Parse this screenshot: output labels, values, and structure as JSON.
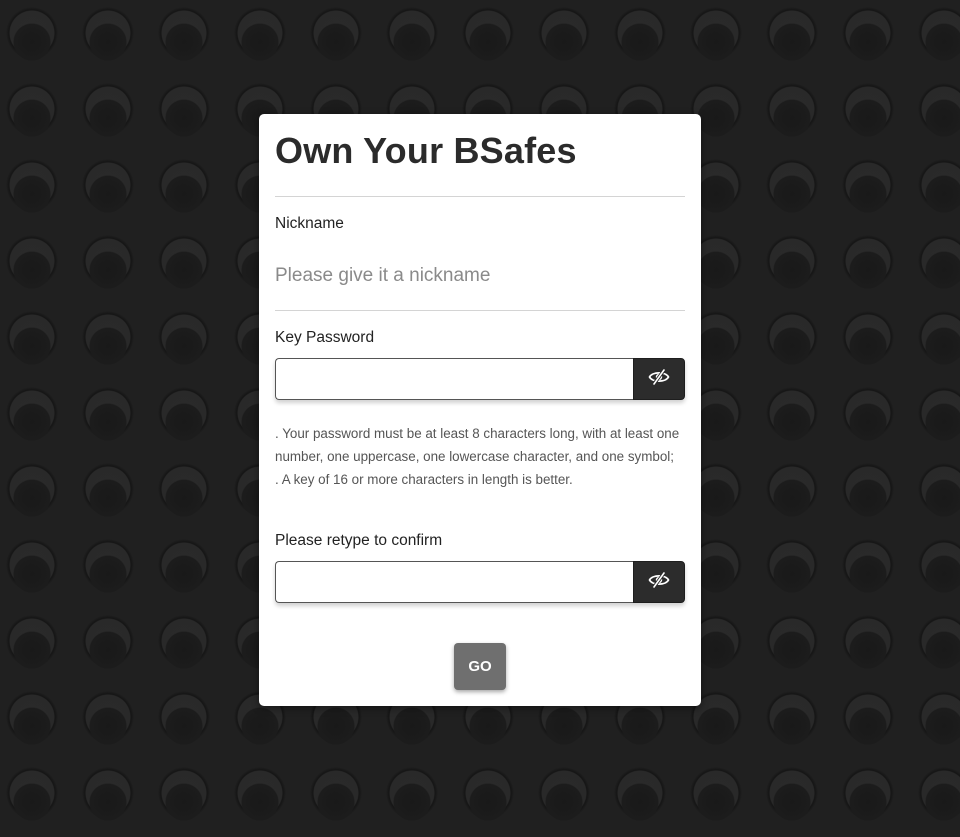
{
  "form": {
    "title": "Own Your BSafes",
    "nickname_label": "Nickname",
    "nickname_placeholder": "Please give it a nickname",
    "nickname_value": "",
    "key_password_label": "Key Password",
    "key_password_value": "",
    "help_lines": [
      ". Your password must be at least 8 characters long, with at least one number, one uppercase, one lowercase character, and one symbol;",
      ". A key of 16 or more characters in length is better."
    ],
    "confirm_label": "Please retype to confirm",
    "confirm_value": "",
    "submit_label": "GO"
  },
  "icons": {
    "toggle_visibility": "eye-slash-icon"
  },
  "colors": {
    "background": "#202020",
    "card": "#ffffff",
    "toggle_button": "#2c2c2c",
    "submit_button": "#6f6f6f"
  }
}
